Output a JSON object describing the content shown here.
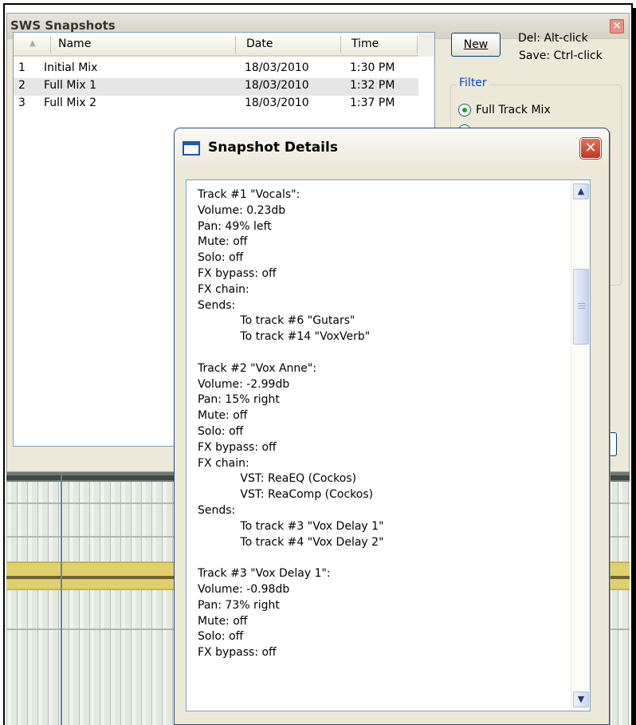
{
  "snapshots_window": {
    "title": "SWS Snapshots",
    "columns": [
      "Name",
      "Date",
      "Time"
    ],
    "rows": [
      {
        "num": "1",
        "name": "Initial Mix",
        "date": "18/03/2010",
        "time": "1:30 PM"
      },
      {
        "num": "2",
        "name": "Full Mix 1",
        "date": "18/03/2010",
        "time": "1:32 PM"
      },
      {
        "num": "3",
        "name": "Full Mix 2",
        "date": "18/03/2010",
        "time": "1:37 PM"
      }
    ],
    "new_button": "New",
    "hint_delete": "Del: Alt-click",
    "hint_save": "Save: Ctrl-click",
    "filter": {
      "label": "Filter",
      "selected_option": "Full Track Mix"
    }
  },
  "details_dialog": {
    "title": "Snapshot Details",
    "text": "Track #1 \"Vocals\":\nVolume: 0.23db\nPan: 49% left\nMute: off\nSolo: off\nFX bypass: off\nFX chain:\nSends:\n            To track #6 \"Gutars\"\n            To track #14 \"VoxVerb\"\n\nTrack #2 \"Vox Anne\":\nVolume: -2.99db\nPan: 15% right\nMute: off\nSolo: off\nFX bypass: off\nFX chain:\n            VST: ReaEQ (Cockos)\n            VST: ReaComp (Cockos)\nSends:\n            To track #3 \"Vox Delay 1\"\n            To track #4 \"Vox Delay 2\"\n\nTrack #3 \"Vox Delay 1\":\nVolume: -0.98db\nPan: 73% right\nMute: off\nSolo: off\nFX bypass: off"
  },
  "colors": {
    "window_bg": "#ece9d8",
    "accent_blue": "#0046d5",
    "close_red": "#c0361e",
    "track_yellow": "#e0cf6d"
  }
}
